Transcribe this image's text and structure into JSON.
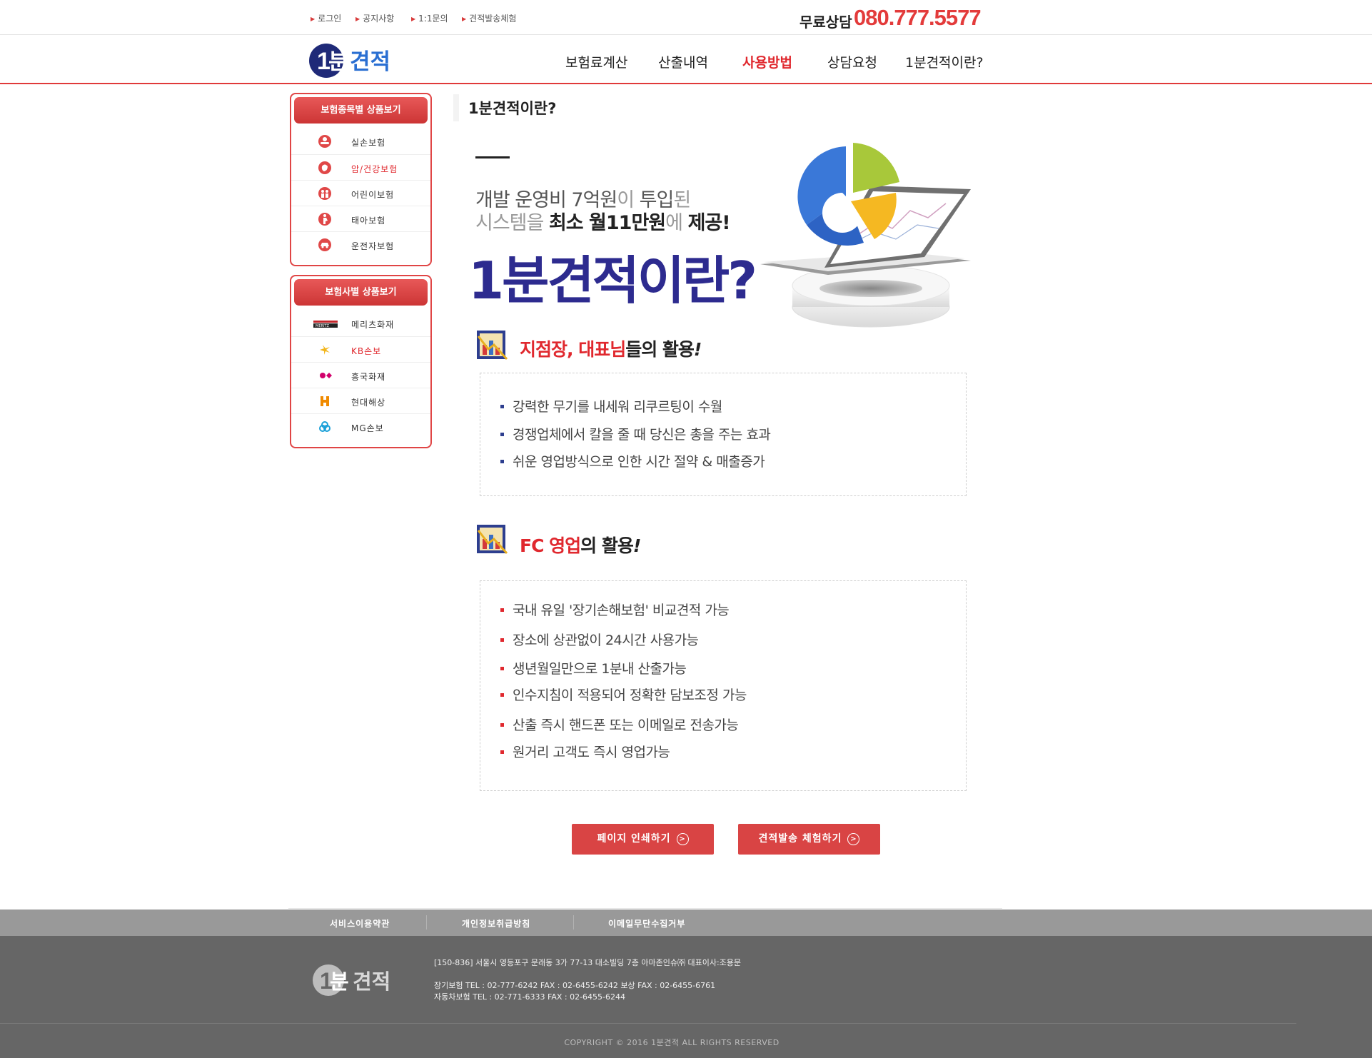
{
  "util_links": [
    "로그인",
    "공지사항",
    "1:1문의",
    "견적발송체험"
  ],
  "consult": {
    "label": "무료상담",
    "phone": "080.777.5577"
  },
  "logo": {
    "num": "1",
    "text1": "분",
    "text2": "견적"
  },
  "nav": [
    "보험료계산",
    "산출내역",
    "사용방법",
    "상담요청",
    "1분견적이란?"
  ],
  "nav_active": "사용방법",
  "sidebar": {
    "by_type": {
      "title": "보험종목별 상품보기",
      "items": [
        "실손보험",
        "암/건강보험",
        "어린이보험",
        "태아보험",
        "운전자보험"
      ]
    },
    "by_company": {
      "title": "보험사별 상품보기",
      "items": [
        "메리츠화재",
        "KB손보",
        "흥국화재",
        "현대해상",
        "MG손보"
      ]
    }
  },
  "page_title": "1분견적이란?",
  "hero": {
    "line1_a": "개발 운영비 7억원",
    "line1_b": "이 ",
    "line1_c": "투입",
    "line1_d": "된",
    "line2_a": "시스템을 ",
    "line2_b": "최소 월11만원",
    "line2_c": "에 ",
    "line2_d": "제공!",
    "big": "1분견적이란?"
  },
  "section1": {
    "title_red": "지점장, 대표님",
    "title_rest": "들의 활용",
    "title_mark": "!",
    "items": [
      "강력한 무기를 내세워 리쿠르팅이 수월",
      "경쟁업체에서 칼을 줄 때 당신은 총을 주는 효과",
      "쉬운 영업방식으로 인한 시간 절약 & 매출증가"
    ]
  },
  "section2": {
    "title_red": "FC 영업",
    "title_rest": "의 활용",
    "title_mark": "!",
    "items": [
      "국내 유일 '장기손해보험' 비교견적 가능",
      "장소에 상관없이 24시간 사용가능",
      "생년월일만으로 1분내 산출가능",
      "인수지침이 적용되어 정확한 담보조정 가능",
      "산출 즉시 핸드폰 또는 이메일로 전송가능",
      "원거리 고객도 즉시 영업가능"
    ]
  },
  "buttons": {
    "print": "페이지 인쇄하기",
    "trial": "견적발송 체험하기"
  },
  "footer": {
    "links": [
      "서비스이용약관",
      "개인정보취급방침",
      "이메일무단수집거부"
    ],
    "address": "[150-836] 서울시 영등포구 문래동 3가 77-13 대소빌딩 7층 아마존인슈㈜ 대표이사:조용문",
    "long_term": "장기보험 TEL : 02-777-6242 FAX : 02-6455-6242 보상 FAX : 02-6455-6761",
    "auto": "자동차보험 TEL : 02-771-6333 FAX : 02-6455-6244",
    "copyright": "COPYRIGHT © 2016 1분견적 ALL RIGHTS RESERVED"
  },
  "colors": {
    "accent": "#e0282e",
    "brand_navy": "#2d2b8f",
    "button": "#d94444",
    "footer_bar": "#999999",
    "footer_bg": "#666666"
  }
}
